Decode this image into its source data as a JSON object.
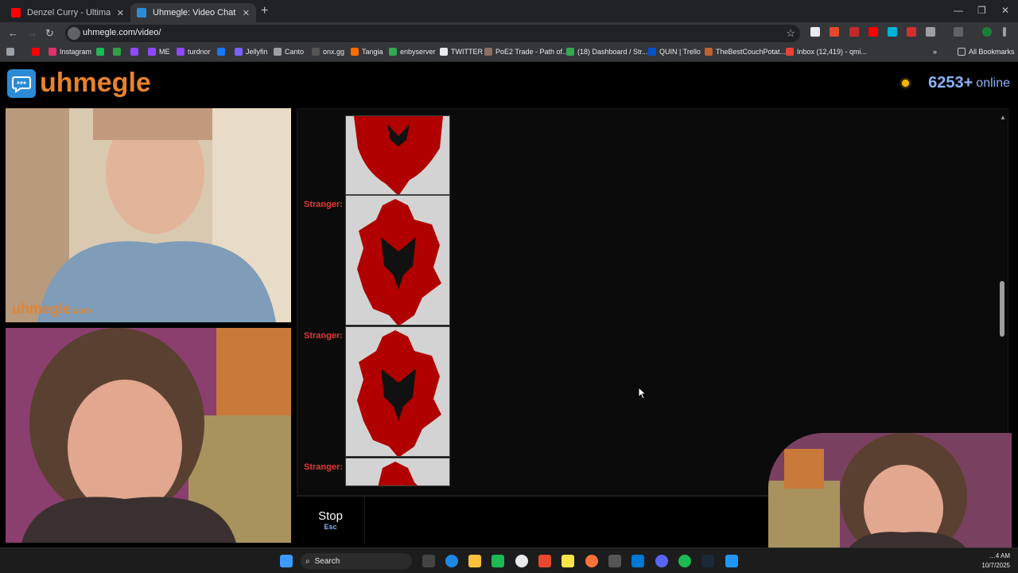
{
  "browser": {
    "tabs": [
      {
        "title": "Denzel Curry - Ultimate (BADB...",
        "active": false,
        "favicon_color": "#ff0000"
      },
      {
        "title": "Uhmegle: Video Chat | Onl...",
        "active": true,
        "favicon_color": "#2d8bd6"
      }
    ],
    "url": "uhmegle.com/video/",
    "bookmarks": [
      {
        "label": "",
        "color": "#ff0000"
      },
      {
        "label": "Instagram",
        "color": "#e1306c"
      },
      {
        "label": "",
        "color": "#1db954"
      },
      {
        "label": "",
        "color": "#2ea043"
      },
      {
        "label": "",
        "color": "#9146ff"
      },
      {
        "label": "ME",
        "color": "#9146ff"
      },
      {
        "label": "turdnor",
        "color": "#9146ff"
      },
      {
        "label": "",
        "color": "#1877f2"
      },
      {
        "label": "Jellyfin",
        "color": "#7b61ff"
      },
      {
        "label": "Canto",
        "color": "#9aa0a6"
      },
      {
        "label": "onx.gg",
        "color": "#333333"
      },
      {
        "label": "Tangia",
        "color": "#ff6d00"
      },
      {
        "label": "enbyserver",
        "color": "#34a853"
      },
      {
        "label": "TWITTER",
        "color": "#000000"
      },
      {
        "label": "PoE2 Trade - Path of...",
        "color": "#8d6e63"
      },
      {
        "label": "(18) Dashboard / Str...",
        "color": "#34a853"
      },
      {
        "label": "QUIN | Trello",
        "color": "#0052cc"
      },
      {
        "label": "TheBestCouchPotat...",
        "color": "#c0622b"
      },
      {
        "label": "Inbox (12,419) - qmi...",
        "color": "#ea4335"
      }
    ],
    "all_bookmarks": "All Bookmarks"
  },
  "site": {
    "logo_text": "uhmegle",
    "online_count": "6253+",
    "online_label": "online",
    "watermark": "uhmegle",
    "watermark_suffix": ".com"
  },
  "chat": {
    "messages": [
      {
        "sender": "",
        "image": "kosovo-albania-flag"
      },
      {
        "sender": "Stranger:",
        "image": "kosovo-albania-flag"
      },
      {
        "sender": "Stranger:",
        "image": "kosovo-albania-flag"
      },
      {
        "sender": "Stranger:",
        "image": "kosovo-albania-flag"
      }
    ]
  },
  "controls": {
    "stop_label": "Stop",
    "stop_key": "Esc"
  },
  "taskbar": {
    "search_label": "Search",
    "time": "…4 AM",
    "date": "10/7/2025"
  },
  "colors": {
    "brand_orange": "#e8822b",
    "brand_blue": "#2d8bd6",
    "stranger_red": "#e53935",
    "flag_red": "#b00000"
  }
}
